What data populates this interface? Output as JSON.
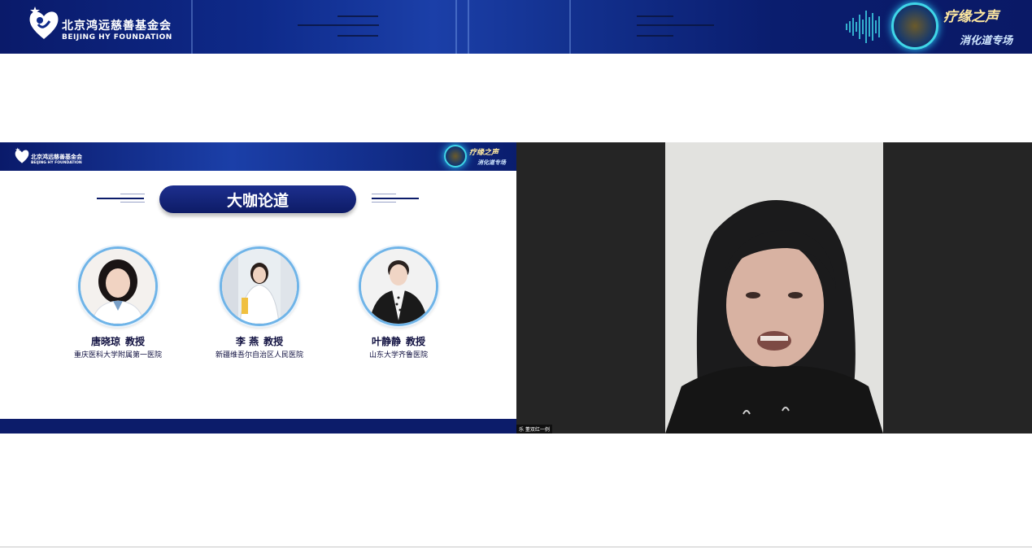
{
  "banner": {
    "org_name_cn": "北京鸿远慈善基金会",
    "org_name_en": "BEIJING HY FOUNDATION",
    "event_title": "疗缘之声",
    "event_subtitle": "消化道专场"
  },
  "slide": {
    "header": {
      "org_name_cn": "北京鸿远慈善基金会",
      "org_name_en": "BEIJING HY FOUNDATION",
      "event_title": "疗缘之声",
      "event_subtitle": "消化道专场"
    },
    "section_title": "大咖论道",
    "speakers": [
      {
        "name": "唐晓琼",
        "title": "教授",
        "org": "重庆医科大学附属第一医院"
      },
      {
        "name": "李  燕",
        "title": "教授",
        "org": "新疆维吾尔自治区人民医院"
      },
      {
        "name": "叶静静",
        "title": "教授",
        "org": "山东大学齐鲁医院"
      }
    ]
  },
  "video": {
    "participant_label": "乐 董双红一例"
  },
  "colors": {
    "brand_navy": "#0c1c6a",
    "accent_cyan": "#3fd6e8",
    "gold": "#ffe9a0"
  }
}
